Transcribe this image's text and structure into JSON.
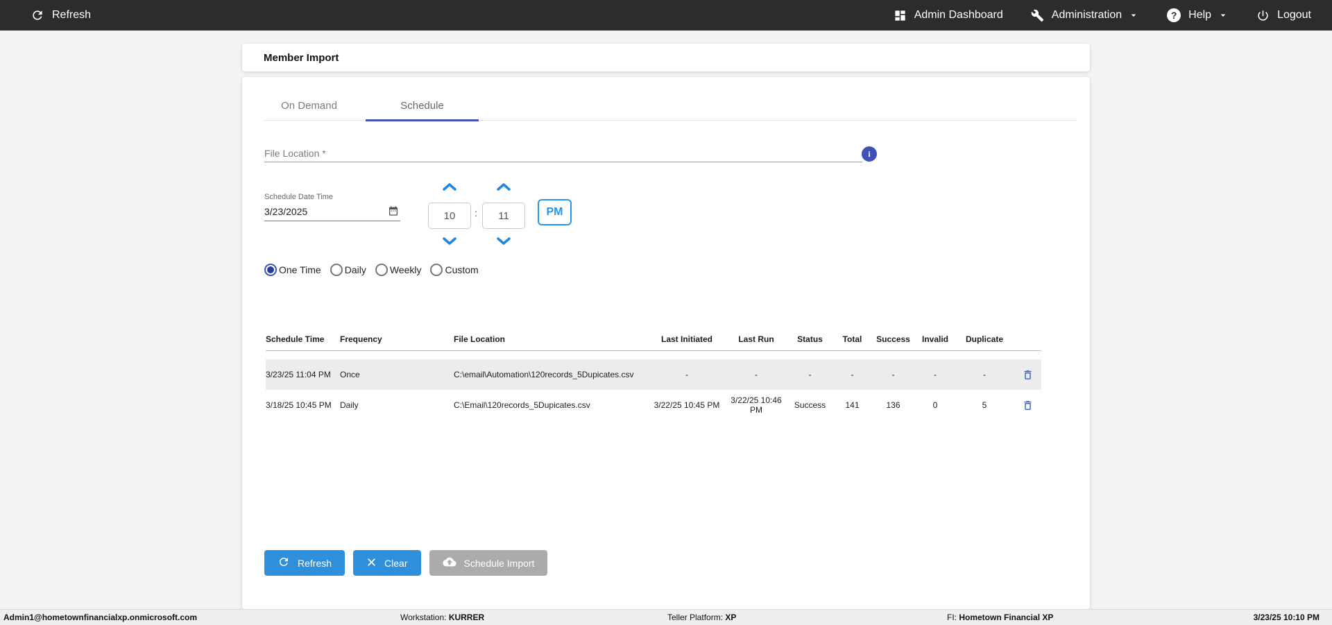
{
  "topbar": {
    "refresh": "Refresh",
    "admin_dashboard": "Admin Dashboard",
    "administration": "Administration",
    "help": "Help",
    "logout": "Logout"
  },
  "page": {
    "title": "Member Import"
  },
  "tabs": [
    {
      "label": "On Demand",
      "active": false
    },
    {
      "label": "Schedule",
      "active": true
    }
  ],
  "form": {
    "file_location": {
      "placeholder": "File Location *",
      "value": ""
    },
    "schedule_date_time": {
      "label": "Schedule Date Time",
      "date": "3/23/2025",
      "hour": "10",
      "colon": ":",
      "minute": "11",
      "meridiem": "PM"
    },
    "frequency_options": [
      {
        "label": "One Time",
        "selected": true
      },
      {
        "label": "Daily",
        "selected": false
      },
      {
        "label": "Weekly",
        "selected": false
      },
      {
        "label": "Custom",
        "selected": false
      }
    ]
  },
  "table": {
    "columns": [
      "Schedule Time",
      "Frequency",
      "File Location",
      "Last Initiated",
      "Last Run",
      "Status",
      "Total",
      "Success",
      "Invalid",
      "Duplicate"
    ],
    "rows": [
      {
        "schedule_time": "3/23/25 11:04 PM",
        "frequency": "Once",
        "file_location": "C:\\email\\Automation\\120records_5Dupicates.csv",
        "last_initiated": "-",
        "last_run": "-",
        "status": "-",
        "total": "-",
        "success": "-",
        "invalid": "-",
        "duplicate": "-",
        "highlighted": true
      },
      {
        "schedule_time": "3/18/25 10:45 PM",
        "frequency": "Daily",
        "file_location": "C:\\Email\\120records_5Dupicates.csv",
        "last_initiated": "3/22/25 10:45 PM",
        "last_run": "3/22/25 10:46 PM",
        "status": "Success",
        "total": "141",
        "success": "136",
        "invalid": "0",
        "duplicate": "5",
        "highlighted": false
      }
    ]
  },
  "actions": {
    "refresh": "Refresh",
    "clear": "Clear",
    "schedule_import": "Schedule Import"
  },
  "footer": {
    "user": "Admin1@hometownfinancialxp.onmicrosoft.com",
    "workstation_label": "Workstation: ",
    "workstation": "KURRER",
    "teller_platform_label": "Teller Platform: ",
    "teller_platform": "XP",
    "fi_label": "FI: ",
    "fi": "Hometown Financial XP",
    "datetime": "3/23/25 10:10 PM"
  },
  "icons": {
    "info": "i",
    "help_glyph": "?"
  },
  "colors": {
    "topbar_bg": "#2c2c2c",
    "accent_indigo": "#3f51b5",
    "accent_blue": "#2196f3",
    "button_blue": "#2e90dd",
    "disabled_gray": "#ababab",
    "trash_blue": "#3060d0",
    "row_highlight": "#ececec"
  }
}
